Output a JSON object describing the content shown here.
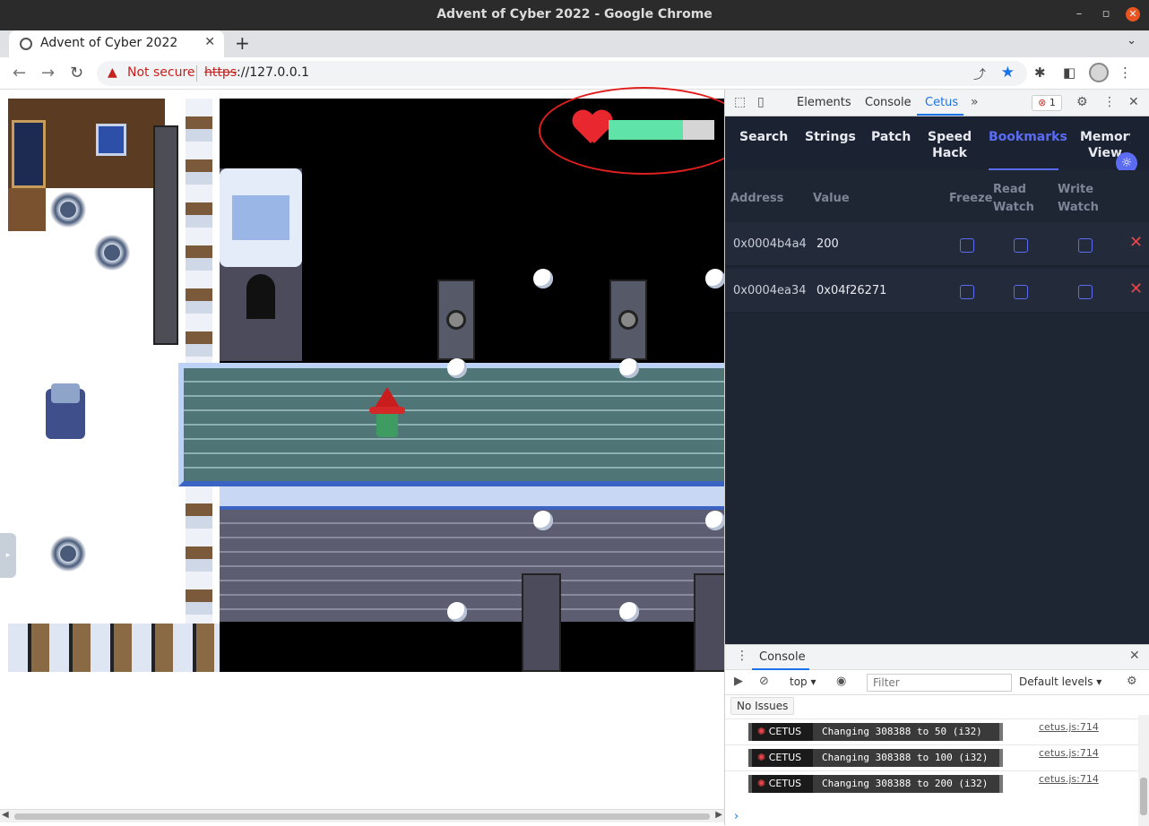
{
  "window": {
    "title": "Advent of Cyber 2022 - Google Chrome"
  },
  "tab": {
    "title": "Advent of Cyber 2022"
  },
  "address_bar": {
    "security_label": "Not secure",
    "url_scheme": "https",
    "url_rest": "://127.0.0.1"
  },
  "game": {
    "health_fraction": 0.7,
    "heart_color": "#e8282e",
    "health_color": "#5fe3a8"
  },
  "devtools": {
    "tabs": [
      "Elements",
      "Console",
      "Cetus"
    ],
    "active_tab": "Cetus",
    "error_count": "1",
    "cetus_nav": [
      "Search",
      "Strings",
      "Patch",
      "Speed\nHack",
      "Bookmarks",
      "Memory\nView"
    ],
    "cetus_active": "Bookmarks",
    "bookmarks": {
      "headers": {
        "address": "Address",
        "value": "Value",
        "freeze": "Freeze",
        "read_watch": "Read\nWatch",
        "write_watch": "Write\nWatch"
      },
      "rows": [
        {
          "address": "0x0004b4a4",
          "value": "200"
        },
        {
          "address": "0x0004ea34",
          "value": "0x04f26271"
        }
      ]
    },
    "console": {
      "title": "Console",
      "context": "top",
      "filter_placeholder": "Filter",
      "levels": "Default levels",
      "no_issues": "No Issues",
      "logs": [
        {
          "tag": "CETUS",
          "message": "Changing 308388 to 50 (i32)",
          "source": "cetus.js:714"
        },
        {
          "tag": "CETUS",
          "message": "Changing 308388 to 100 (i32)",
          "source": "cetus.js:714"
        },
        {
          "tag": "CETUS",
          "message": "Changing 308388 to 200 (i32)",
          "source": "cetus.js:714"
        }
      ]
    }
  }
}
